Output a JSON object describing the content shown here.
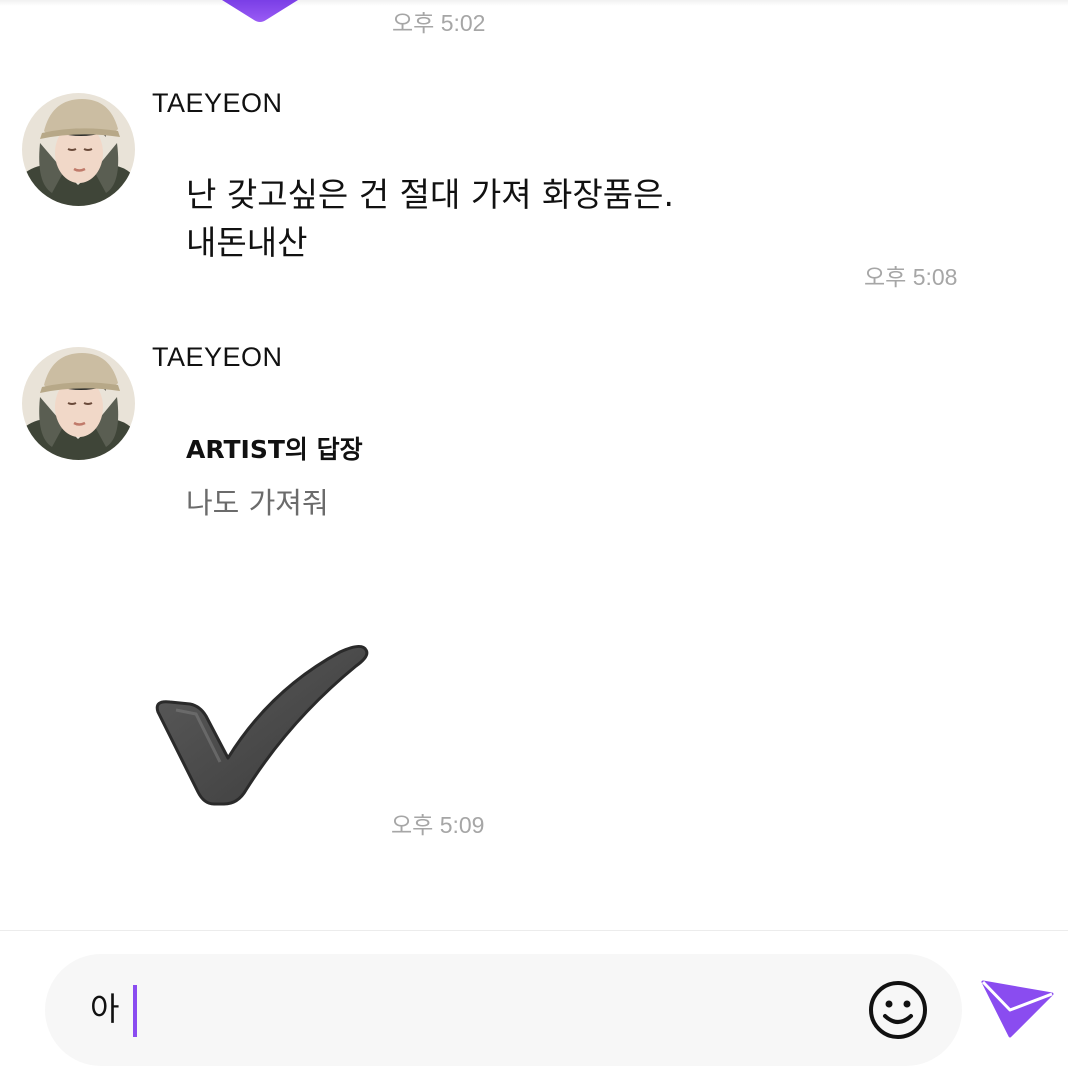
{
  "chat": {
    "top_timestamp": "오후 5:02",
    "messages": [
      {
        "sender": "TAEYEON",
        "text_lines": [
          "난 갖고싶은 건 절대 가져 화장품은.",
          "내돈내산"
        ],
        "time": "오후 5:08"
      },
      {
        "sender": "TAEYEON",
        "reply_label": "ARTIST의 답장",
        "reply_text": "나도 가져줘",
        "sticker_icon": "heavy-check-mark-icon",
        "time": "오후 5:09"
      }
    ]
  },
  "composer": {
    "input_value": "아",
    "emoji_icon": "smiley-face-icon",
    "send_icon": "paper-plane-send-icon"
  },
  "colors": {
    "accent": "#8a4cf0",
    "timestamp": "#a6a6a6",
    "reply_text": "#6b6b6b"
  }
}
